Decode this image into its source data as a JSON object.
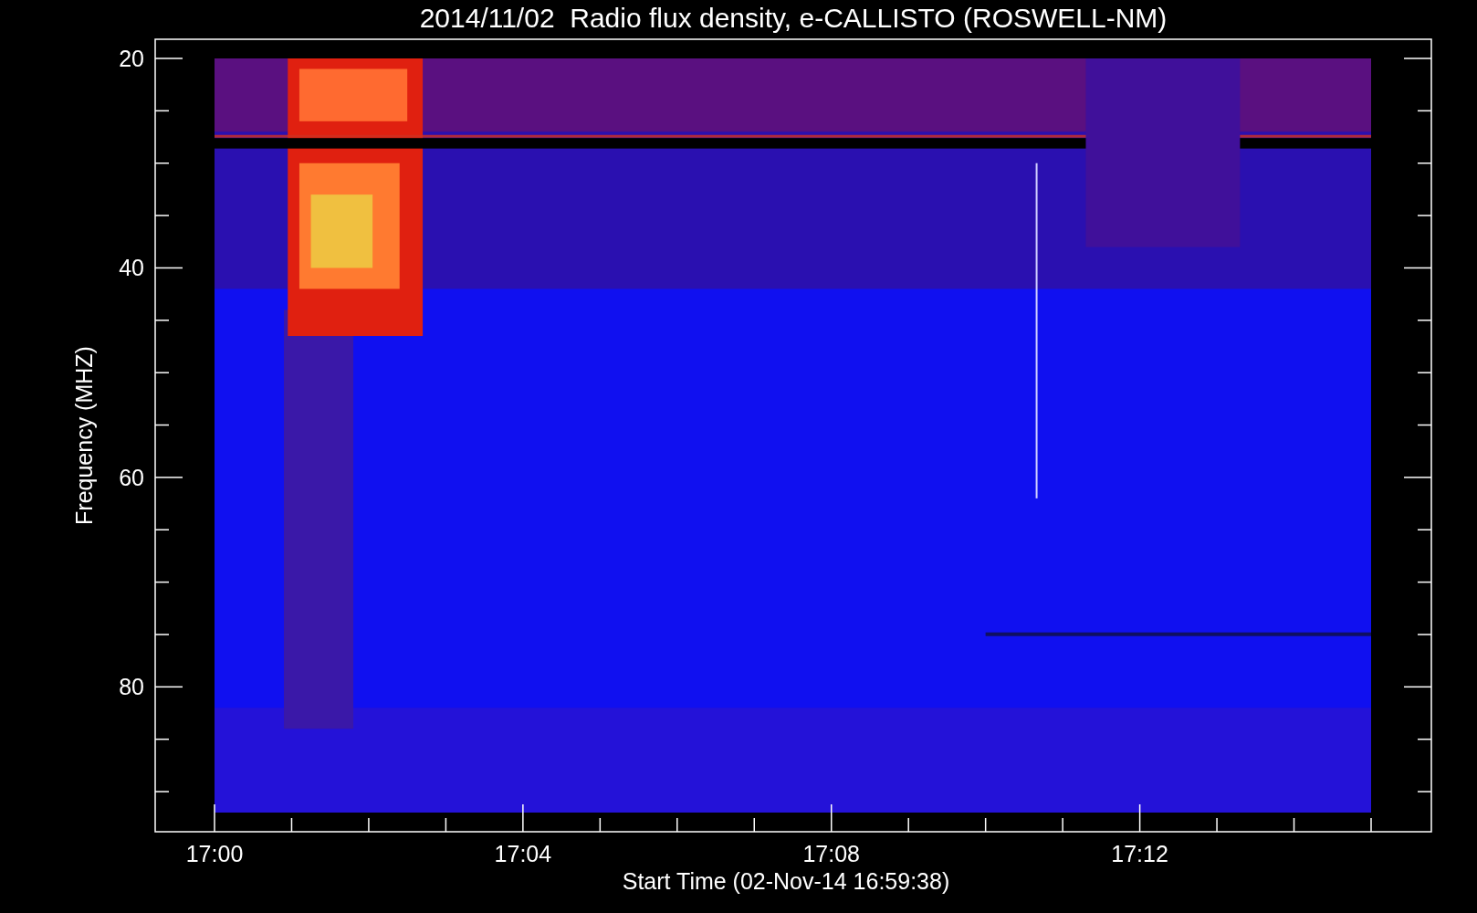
{
  "plot": {
    "title": "2014/11/02  Radio flux density, e-CALLISTO (ROSWELL-NM)",
    "xlabel": "Start Time (02-Nov-14 16:59:38)",
    "ylabel": "Frequency (MHZ)",
    "xtick_labels": [
      "17:00",
      "17:04",
      "17:08",
      "17:12"
    ],
    "ytick_labels": [
      "20",
      "40",
      "60",
      "80"
    ]
  }
}
